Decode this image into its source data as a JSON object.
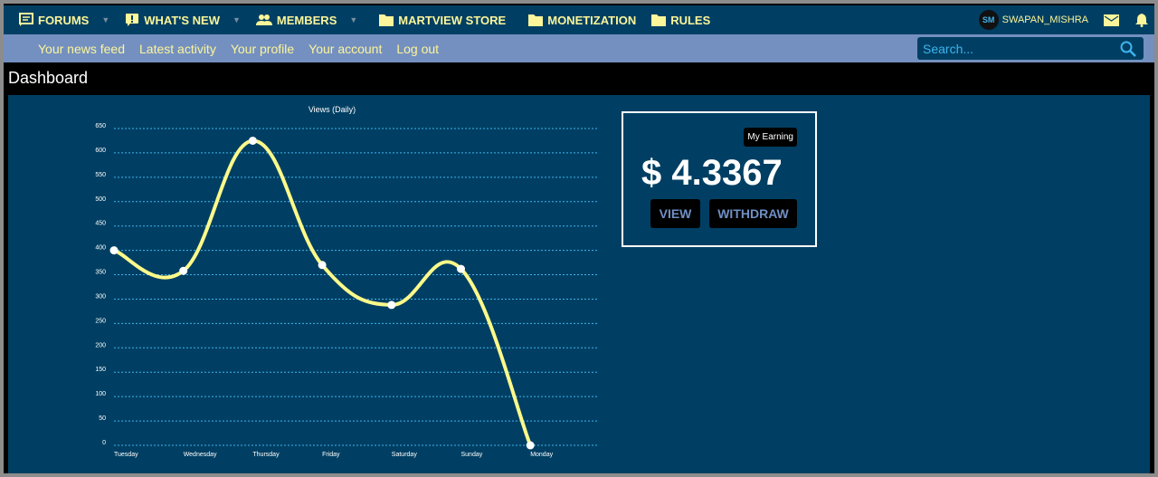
{
  "nav": {
    "items": [
      {
        "label": "FORUMS",
        "icon": "forum-icon",
        "caret": true
      },
      {
        "label": "WHAT'S NEW",
        "icon": "whats-new-icon",
        "caret": true
      },
      {
        "label": "MEMBERS",
        "icon": "members-icon",
        "caret": true
      },
      {
        "label": "MARTVIEW STORE",
        "icon": "folder-icon"
      },
      {
        "label": "MONETIZATION",
        "icon": "folder-icon"
      },
      {
        "label": "RULES",
        "icon": "folder-icon"
      }
    ],
    "user": {
      "initials": "SM",
      "name": "SWAPAN_MISHRA"
    }
  },
  "subnav": {
    "items": [
      "Your news feed",
      "Latest activity",
      "Your profile",
      "Your account",
      "Log out"
    ],
    "search_placeholder": "Search..."
  },
  "page_title": "Dashboard",
  "earning": {
    "tag": "My Earning",
    "amount": "$ 4.3367",
    "view": "VIEW",
    "withdraw": "WITHDRAW"
  },
  "chart_data": {
    "type": "line",
    "title": "Views (Daily)",
    "categories": [
      "Tuesday",
      "Wednesday",
      "Thursday",
      "Friday",
      "Saturday",
      "Sunday",
      "Monday"
    ],
    "values": [
      400,
      358,
      625,
      370,
      288,
      362,
      0
    ],
    "ylim": [
      0,
      650
    ],
    "yticks": [
      0,
      50,
      100,
      150,
      200,
      250,
      300,
      350,
      400,
      450,
      500,
      550,
      600,
      650
    ],
    "grid": true,
    "line_color": "#fdf98a"
  }
}
